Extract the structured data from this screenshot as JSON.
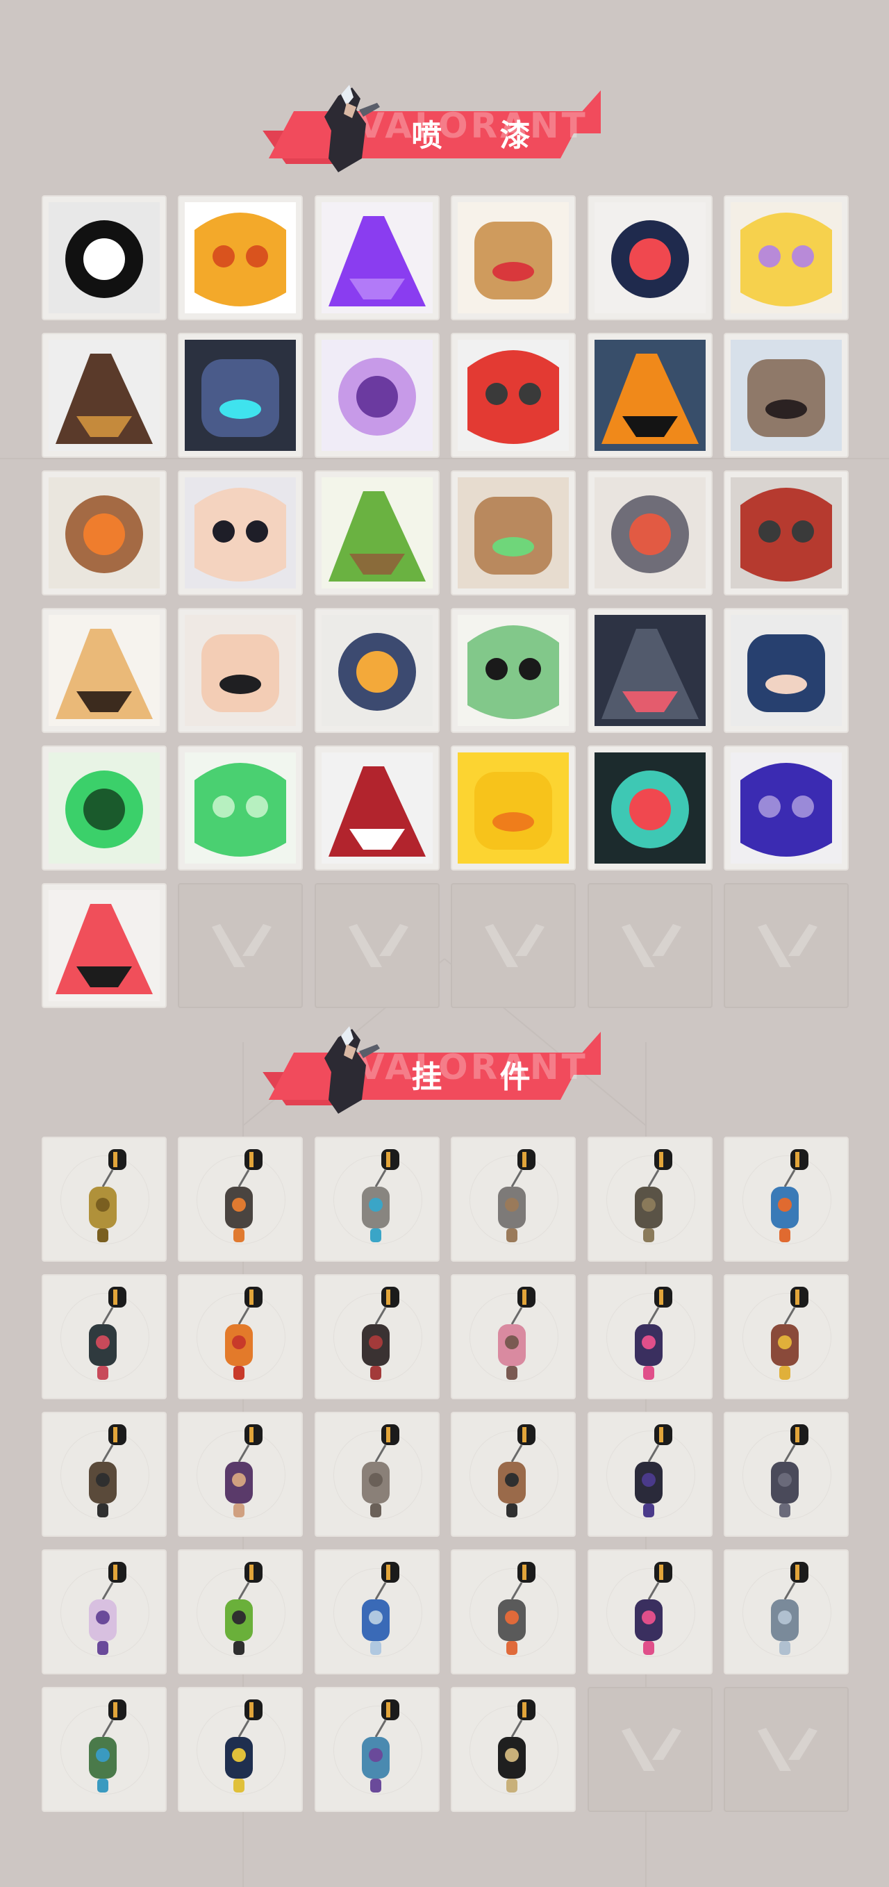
{
  "sections": {
    "sprays": {
      "title": "喷 漆",
      "watermark": "VALORANT"
    },
    "charms": {
      "title": "挂 件",
      "watermark": "VALORANT"
    }
  },
  "sprays": [
    {
      "name": "black-star-spray",
      "bg": "#e8e8e8",
      "main": "#111111",
      "accent": "#ffffff"
    },
    {
      "name": "orange-mask-spray",
      "bg": "#ffffff",
      "main": "#f3a92a",
      "accent": "#d9531e"
    },
    {
      "name": "purple-scribble-spray",
      "bg": "#f4f1f6",
      "main": "#8a3df0",
      "accent": "#b27af8"
    },
    {
      "name": "goggles-face-spray",
      "bg": "#f7f2ea",
      "main": "#cf9b5d",
      "accent": "#d9383c"
    },
    {
      "name": "navy-chevron-spray",
      "bg": "#f2f0ee",
      "main": "#1f2a4d",
      "accent": "#f0484f"
    },
    {
      "name": "sleepy-creature-spray",
      "bg": "#f4efe6",
      "main": "#f6d14d",
      "accent": "#b88ad8"
    },
    {
      "name": "pixel-agent-spray",
      "bg": "#eeeeee",
      "main": "#5a3a2a",
      "accent": "#c58a3c"
    },
    {
      "name": "robot-head-spray",
      "bg": "#2b3140",
      "main": "#4a5b8a",
      "accent": "#3fe3ee"
    },
    {
      "name": "purple-ghost-spray",
      "bg": "#f0ecf7",
      "main": "#c79ae8",
      "accent": "#6b3aa0"
    },
    {
      "name": "clown-face-spray",
      "bg": "#f1f1f1",
      "main": "#e33a33",
      "accent": "#3a3a3a"
    },
    {
      "name": "orange-button-spray",
      "bg": "#384e6a",
      "main": "#f0891a",
      "accent": "#141414"
    },
    {
      "name": "raccoon-spray",
      "bg": "#d7e0ea",
      "main": "#8f7969",
      "accent": "#2b2222"
    },
    {
      "name": "bearded-agent-spray",
      "bg": "#eae6de",
      "main": "#a46a44",
      "accent": "#ef7d2d"
    },
    {
      "name": "anime-boy-spray",
      "bg": "#e8e7ec",
      "main": "#f4d3bf",
      "accent": "#1e1e28"
    },
    {
      "name": "green-box-spray",
      "bg": "#f3f5ea",
      "main": "#6ab241",
      "accent": "#8a6b3a"
    },
    {
      "name": "green-eyes-spray",
      "bg": "#e7dccf",
      "main": "#b9895e",
      "accent": "#6fd67a"
    },
    {
      "name": "crying-creature-spray",
      "bg": "#e9e4df",
      "main": "#6f6d78",
      "accent": "#e25a43"
    },
    {
      "name": "red-blade-spray",
      "bg": "#d9d4d0",
      "main": "#b63a2f",
      "accent": "#3a3a3a"
    },
    {
      "name": "tiger-cub-spray",
      "bg": "#f6f3ee",
      "main": "#eab978",
      "accent": "#3c2b1e"
    },
    {
      "name": "girl-with-pencil-spray",
      "bg": "#efe9e4",
      "main": "#f3cdb5",
      "accent": "#1f1f22"
    },
    {
      "name": "penguin-beanie-spray",
      "bg": "#ecebe8",
      "main": "#3c4a70",
      "accent": "#f3a93a"
    },
    {
      "name": "frog-spray",
      "bg": "#f4f4ef",
      "main": "#82c88a",
      "accent": "#1a1a1a"
    },
    {
      "name": "grey-cat-spray",
      "bg": "#2d3344",
      "main": "#525a6c",
      "accent": "#e45c6d"
    },
    {
      "name": "hooded-agent-spray",
      "bg": "#ebebeb",
      "main": "#27406f",
      "accent": "#f1d3c3"
    },
    {
      "name": "green-snake-spray",
      "bg": "#e8f4e5",
      "main": "#3bd06a",
      "accent": "#1a5a2c"
    },
    {
      "name": "green-orb-spray",
      "bg": "#f1f6ef",
      "main": "#4ad071",
      "accent": "#b7f0c0"
    },
    {
      "name": "red-x-button-spray",
      "bg": "#f2f2f2",
      "main": "#b2242d",
      "accent": "#ffffff"
    },
    {
      "name": "duck-face-spray",
      "bg": "#fcd431",
      "main": "#f7c31b",
      "accent": "#ef7d1b"
    },
    {
      "name": "v-logo-teal-spray",
      "bg": "#1c2b2d",
      "main": "#3ec8b4",
      "accent": "#f0484f"
    },
    {
      "name": "graffiti-tag-spray",
      "bg": "#f0eff2",
      "main": "#3b2bb2",
      "accent": "#9a8ad8"
    },
    {
      "name": "v-logo-red-spray",
      "bg": "#f3f1ef",
      "main": "#f04f5a",
      "accent": "#1c1c1c"
    },
    {
      "name": "empty",
      "bg": "",
      "main": "",
      "accent": ""
    },
    {
      "name": "empty",
      "bg": "",
      "main": "",
      "accent": ""
    },
    {
      "name": "empty",
      "bg": "",
      "main": "",
      "accent": ""
    },
    {
      "name": "empty",
      "bg": "",
      "main": "",
      "accent": ""
    },
    {
      "name": "empty",
      "bg": "",
      "main": "",
      "accent": ""
    }
  ],
  "charms": [
    {
      "name": "gold-figure-charm",
      "body": "#b0913a",
      "accent": "#7a5f20"
    },
    {
      "name": "sentinel-drone-charm",
      "body": "#4a4440",
      "accent": "#e07a30"
    },
    {
      "name": "blue-ribbon-charm",
      "body": "#888580",
      "accent": "#3aa5c7"
    },
    {
      "name": "raccoon-figure-charm",
      "body": "#7d7a78",
      "accent": "#9a7a5a"
    },
    {
      "name": "sphere-bag-charm",
      "body": "#5a5346",
      "accent": "#8a7a5a"
    },
    {
      "name": "blue-bottle-charm",
      "body": "#3a7ab7",
      "accent": "#e06a30"
    },
    {
      "name": "chain-blade-charm",
      "body": "#2f3a3e",
      "accent": "#c84a5a"
    },
    {
      "name": "orange-drop-charm",
      "body": "#e37a2a",
      "accent": "#c83a2a"
    },
    {
      "name": "braided-cord-charm",
      "body": "#3a3232",
      "accent": "#a33a3a"
    },
    {
      "name": "cupcake-charm",
      "body": "#d98aa0",
      "accent": "#7a5a52"
    },
    {
      "name": "ep9-badge-charm",
      "body": "#3a2f5f",
      "accent": "#e04f8a"
    },
    {
      "name": "bear-bell-charm",
      "body": "#8a4a3a",
      "accent": "#e0b03a"
    },
    {
      "name": "mechanism-charm",
      "body": "#5a4a3a",
      "accent": "#2f2f2f"
    },
    {
      "name": "agent-figure-charm",
      "body": "#5a3a6a",
      "accent": "#d0a080"
    },
    {
      "name": "cowboy-figure-charm",
      "body": "#8a8078",
      "accent": "#6a6058"
    },
    {
      "name": "crate-charm",
      "body": "#9a6a4a",
      "accent": "#2f2f2f"
    },
    {
      "name": "witch-tassel-charm",
      "body": "#2a2a3a",
      "accent": "#4a3a8a"
    },
    {
      "name": "spiked-charm",
      "body": "#4a4a5a",
      "accent": "#6a6a7a"
    },
    {
      "name": "lava-lamp-charm",
      "body": "#d8c0e0",
      "accent": "#6a4a9a"
    },
    {
      "name": "green-pager-charm",
      "body": "#6ab03a",
      "accent": "#2f2f2f"
    },
    {
      "name": "astronaut-charm",
      "body": "#3a6ab7",
      "accent": "#b0c8e0"
    },
    {
      "name": "walkie-device-charm",
      "body": "#5a5a5a",
      "accent": "#e06a3a"
    },
    {
      "name": "ep9-badge-charm",
      "body": "#3a2f5f",
      "accent": "#e04f8a"
    },
    {
      "name": "card-tag-charm",
      "body": "#7a8a9a",
      "accent": "#b0c0d0"
    },
    {
      "name": "green-can-charm",
      "body": "#4a7a4a",
      "accent": "#3a9ac0"
    },
    {
      "name": "ep9-badge-charm",
      "body": "#1f2f4f",
      "accent": "#e0c03a"
    },
    {
      "name": "ufo-charm",
      "body": "#4a8ab0",
      "accent": "#6a4a9a"
    },
    {
      "name": "valorant-coin-charm",
      "body": "#1f1f1f",
      "accent": "#c8b07a"
    },
    {
      "name": "empty",
      "body": "",
      "accent": ""
    },
    {
      "name": "empty",
      "body": "",
      "accent": ""
    }
  ]
}
